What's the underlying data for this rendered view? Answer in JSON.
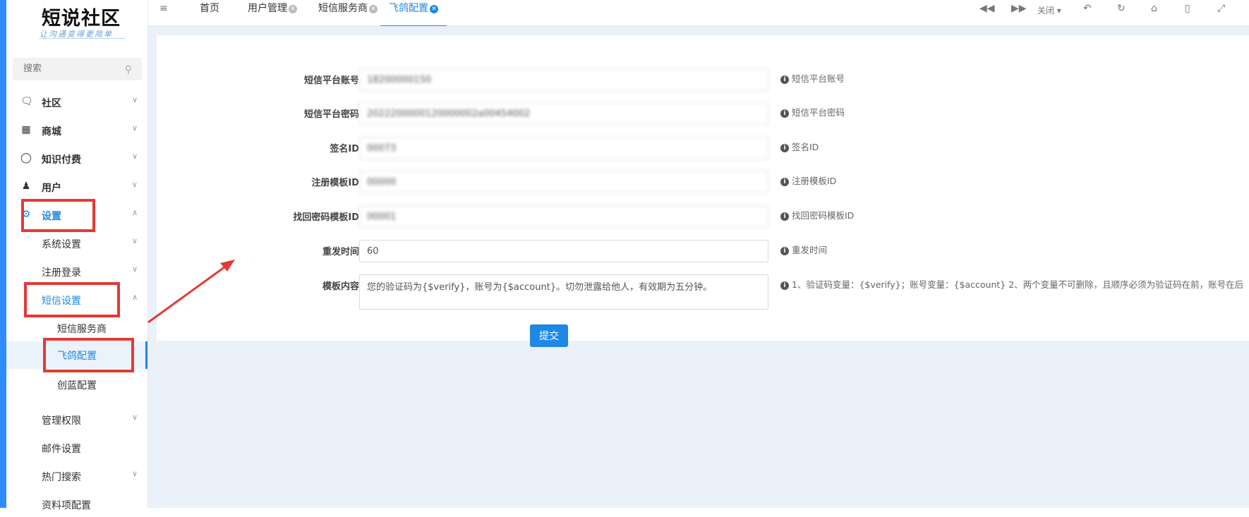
{
  "logo": {
    "title": "短说社区",
    "subtitle": "让沟通变得更简单"
  },
  "search": {
    "placeholder": "搜索"
  },
  "sidebar": {
    "items": [
      {
        "label": "社区"
      },
      {
        "label": "商城"
      },
      {
        "label": "知识付费"
      },
      {
        "label": "用户"
      },
      {
        "label": "设置"
      },
      {
        "label": "系统设置"
      },
      {
        "label": "注册登录"
      },
      {
        "label": "短信设置"
      },
      {
        "label": "短信服务商"
      },
      {
        "label": "飞鸽配置"
      },
      {
        "label": "创蓝配置"
      },
      {
        "label": "管理权限"
      },
      {
        "label": "邮件设置"
      },
      {
        "label": "热门搜索"
      },
      {
        "label": "资料项配置"
      }
    ]
  },
  "tabs": [
    {
      "label": "首页"
    },
    {
      "label": "用户管理"
    },
    {
      "label": "短信服务商"
    },
    {
      "label": "飞鸽配置"
    }
  ],
  "toolbar": {
    "close_label": "关闭"
  },
  "form": {
    "fields": [
      {
        "label": "短信平台账号",
        "value": "18200000150",
        "hint": "短信平台账号"
      },
      {
        "label": "短信平台密码",
        "value": "2022200000120000002a00454002",
        "hint": "短信平台密码"
      },
      {
        "label": "签名ID",
        "value": "00073",
        "hint": "签名ID"
      },
      {
        "label": "注册模板ID",
        "value": "00000",
        "hint": "注册模板ID"
      },
      {
        "label": "找回密码模板ID",
        "value": "00001",
        "hint": "找回密码模板ID"
      },
      {
        "label": "重发时间",
        "value": "60",
        "hint": "重发时间"
      },
      {
        "label": "模板内容",
        "value": "您的验证码为{$verify}，账号为{$account}。切勿泄露给他人，有效期为五分钟。",
        "hint": "1、验证码变量：{$verify}；账号变量：{$account} 2、两个变量不可删除，且顺序必须为验证码在前，账号在后"
      }
    ],
    "submit_label": "提交"
  },
  "colors": {
    "accent": "#1e88e5",
    "highlight_box": "#e53935",
    "background": "#ebf1f8"
  }
}
